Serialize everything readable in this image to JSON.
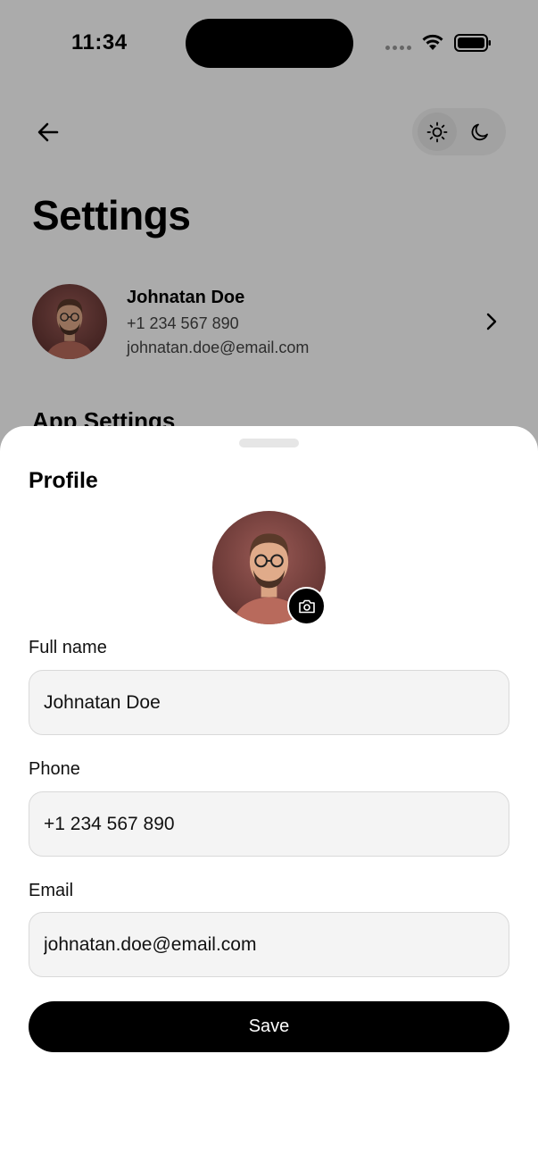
{
  "status_bar": {
    "time": "11:34"
  },
  "header": {
    "back_icon": "arrow-left-icon",
    "theme_toggle": {
      "options": [
        "sun-icon",
        "moon-icon"
      ],
      "selected": "light"
    }
  },
  "page": {
    "title": "Settings"
  },
  "profile_summary": {
    "name": "Johnatan Doe",
    "phone": "+1 234 567 890",
    "email": "johnatan.doe@email.com"
  },
  "app_settings": {
    "heading": "App Settings"
  },
  "sheet": {
    "title": "Profile",
    "camera_icon": "camera-icon",
    "fields": {
      "full_name": {
        "label": "Full name",
        "value": "Johnatan Doe"
      },
      "phone": {
        "label": "Phone",
        "value": "+1 234 567 890"
      },
      "email": {
        "label": "Email",
        "value": "johnatan.doe@email.com"
      }
    },
    "save_label": "Save"
  },
  "colors": {
    "accent": "#000000",
    "input_background": "#f4f4f4",
    "input_border": "#d9d9d9",
    "overlay": "rgba(0,0,0,0.33)"
  }
}
